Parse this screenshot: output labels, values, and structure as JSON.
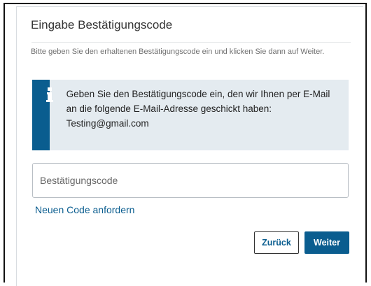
{
  "dialog": {
    "title": "Eingabe Bestätigungscode",
    "description": "Bitte geben Sie den erhaltenen Bestätigungscode ein und klicken Sie dann auf Weiter.",
    "info": {
      "icon": "info-icon",
      "text": "Geben Sie den Bestätigungscode ein, den wir Ihnen per E-Mail an die folgende E-Mail-Adresse geschickt haben: Testing@gmail.com"
    },
    "code_field": {
      "placeholder": "Bestätigungscode",
      "value": ""
    },
    "request_new_code_label": "Neuen Code anfordern",
    "buttons": {
      "back_label": "Zurück",
      "next_label": "Weiter"
    }
  },
  "colors": {
    "accent": "#0a5d8f",
    "info_background": "#e4ebf0",
    "text": "#333333"
  }
}
